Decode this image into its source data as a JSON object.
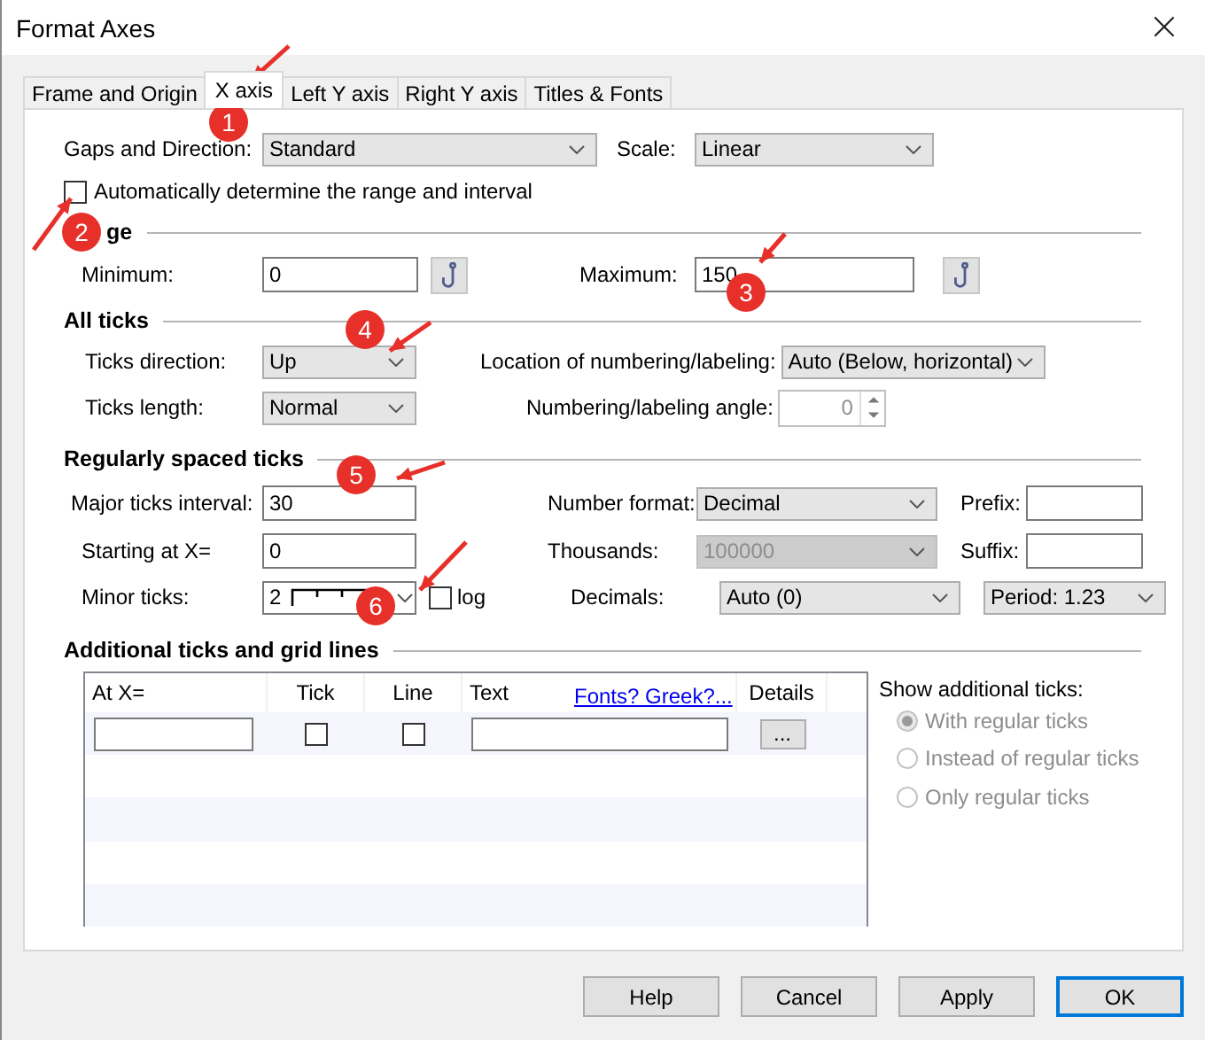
{
  "window": {
    "title": "Format Axes",
    "close": "×"
  },
  "tabs": [
    {
      "label": "Frame and Origin",
      "selected": false
    },
    {
      "label": "X axis",
      "selected": true
    },
    {
      "label": "Left Y axis",
      "selected": false
    },
    {
      "label": "Right Y axis",
      "selected": false
    },
    {
      "label": "Titles & Fonts",
      "selected": false
    }
  ],
  "gaps": {
    "label": "Gaps and Direction:",
    "value": "Standard"
  },
  "scale": {
    "label": "Scale:",
    "value": "Linear"
  },
  "auto_range": {
    "label": "Automatically determine the range and interval",
    "checked": false
  },
  "range": {
    "heading": "ge",
    "minimum": {
      "label": "Minimum:",
      "value": "0"
    },
    "maximum": {
      "label": "Maximum:",
      "value": "150"
    }
  },
  "all_ticks": {
    "heading": "All ticks",
    "direction": {
      "label": "Ticks direction:",
      "value": "Up"
    },
    "location": {
      "label": "Location of numbering/labeling:",
      "value": "Auto (Below, horizontal)"
    },
    "length": {
      "label": "Ticks length:",
      "value": "Normal"
    },
    "angle": {
      "label": "Numbering/labeling angle:",
      "value": "0",
      "disabled": true
    }
  },
  "regular": {
    "heading": "Regularly spaced ticks",
    "major": {
      "label": "Major ticks interval:",
      "value": "30"
    },
    "number_format": {
      "label": "Number format:",
      "value": "Decimal"
    },
    "prefix": {
      "label": "Prefix:"
    },
    "starting": {
      "label": "Starting at X=",
      "value": "0"
    },
    "thousands": {
      "label": "Thousands:",
      "value": "100000",
      "disabled": true
    },
    "suffix": {
      "label": "Suffix:"
    },
    "minor": {
      "label": "Minor ticks:",
      "value": "2"
    },
    "log": {
      "label": "log",
      "checked": false
    },
    "decimals": {
      "label": "Decimals:",
      "value": "Auto (0)"
    },
    "period": {
      "value": "Period: 1.23"
    }
  },
  "additional": {
    "heading": "Additional ticks and grid lines",
    "columns": [
      "At X=",
      "Tick",
      "Line",
      "Text",
      "Details"
    ],
    "link": "Fonts? Greek?...",
    "rows": [
      {
        "tick": false,
        "line": false,
        "details": "..."
      }
    ],
    "show": {
      "label": "Show additional ticks:",
      "disabled": true,
      "options": [
        {
          "label": "With regular ticks",
          "selected": true
        },
        {
          "label": "Instead of regular ticks",
          "selected": false
        },
        {
          "label": "Only regular ticks",
          "selected": false
        }
      ]
    }
  },
  "buttons": [
    {
      "label": "Help",
      "default": false
    },
    {
      "label": "Cancel",
      "default": false
    },
    {
      "label": "Apply",
      "default": false
    },
    {
      "label": "OK",
      "default": true
    }
  ],
  "annotations": [
    {
      "number": "1"
    },
    {
      "number": "2"
    },
    {
      "number": "3"
    },
    {
      "number": "4"
    },
    {
      "number": "5"
    },
    {
      "number": "6"
    }
  ]
}
